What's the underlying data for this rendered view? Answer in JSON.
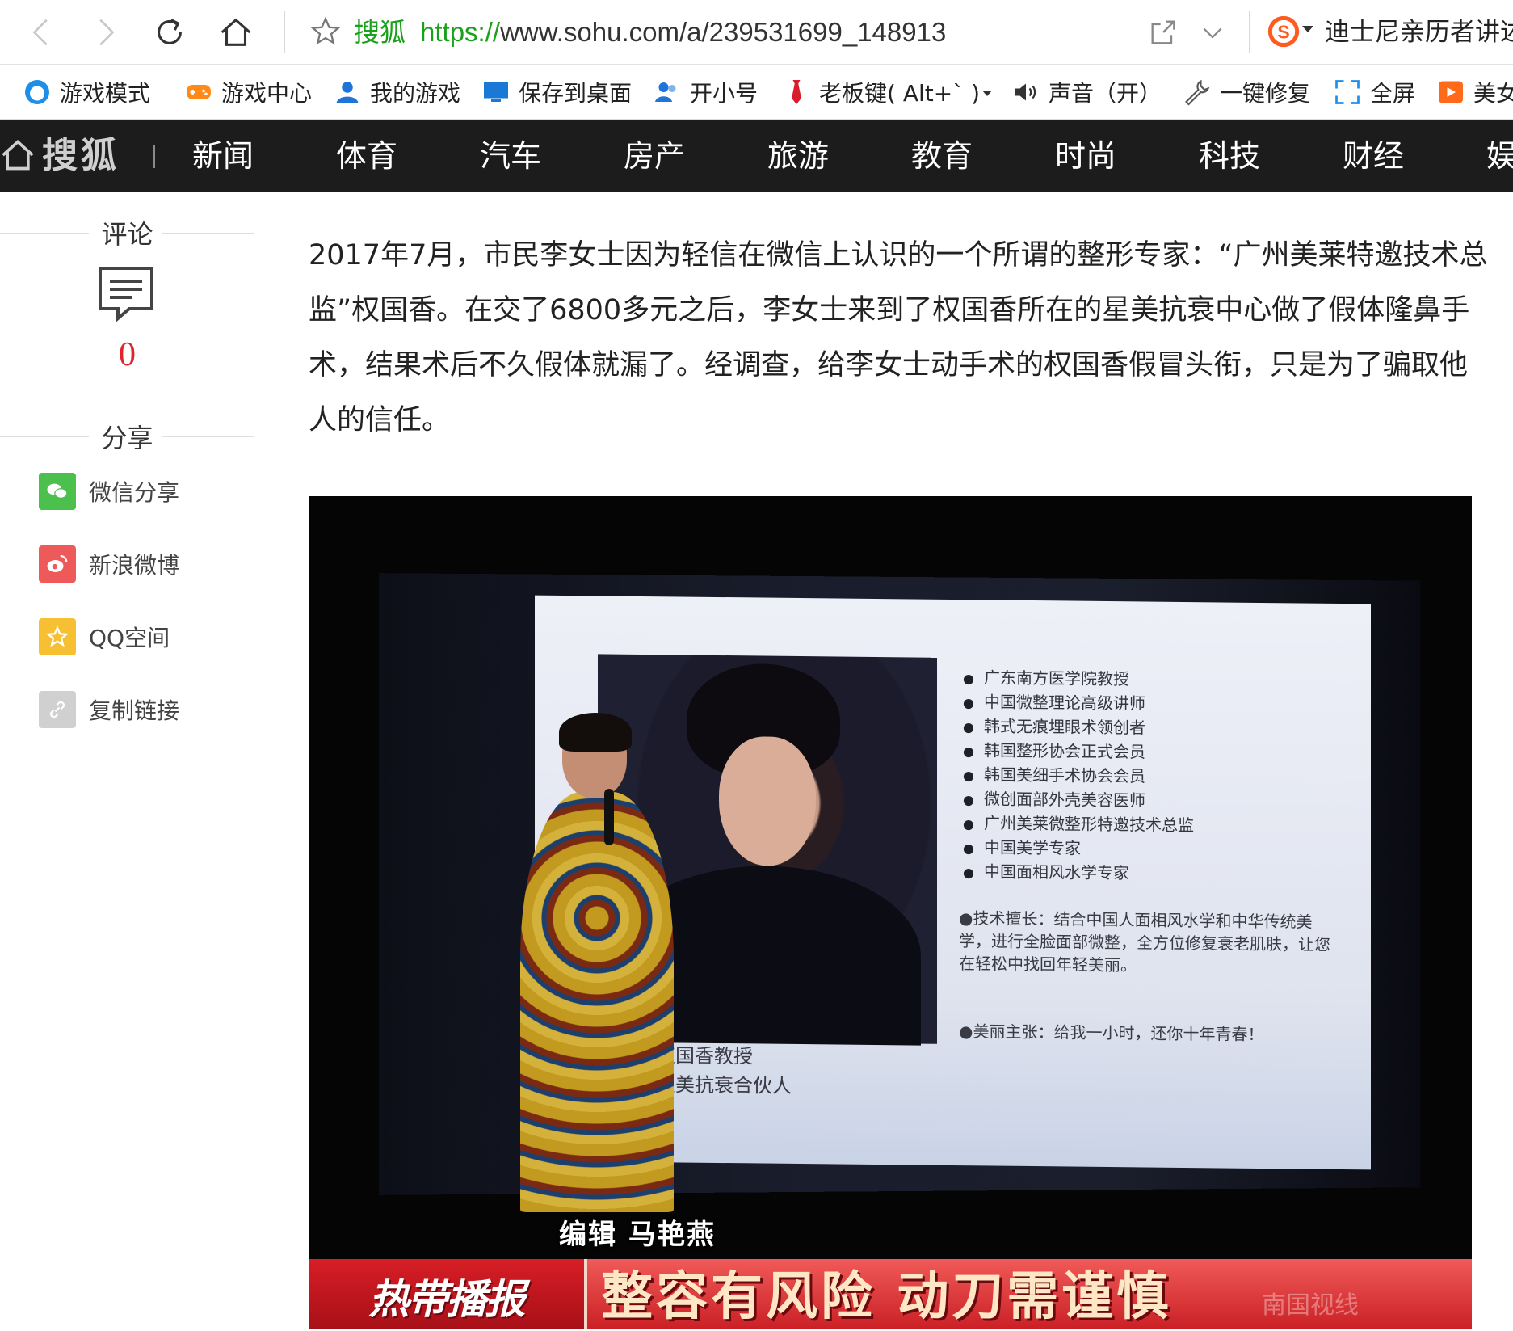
{
  "browser": {
    "site_name": "搜狐",
    "url_scheme": "https://",
    "url_rest": "www.sohu.com/a/239531699_148913",
    "search_hint": "迪士尼亲历者讲述"
  },
  "bookmarks": [
    {
      "label": "游戏模式",
      "icon": "game-mode-icon"
    },
    {
      "label": "游戏中心",
      "icon": "gamepad-icon"
    },
    {
      "label": "我的游戏",
      "icon": "user-icon"
    },
    {
      "label": "保存到桌面",
      "icon": "monitor-icon"
    },
    {
      "label": "开小号",
      "icon": "users-icon"
    },
    {
      "label": "老板键( Alt+` )",
      "icon": "necktie-icon"
    },
    {
      "label": "声音（开）",
      "icon": "speaker-icon"
    },
    {
      "label": "一键修复",
      "icon": "wrench-icon"
    },
    {
      "label": "全屏",
      "icon": "fullscreen-icon"
    },
    {
      "label": "美女",
      "icon": "play-icon"
    }
  ],
  "sohu_nav": {
    "logo": "搜狐",
    "items": [
      "新闻",
      "体育",
      "汽车",
      "房产",
      "旅游",
      "教育",
      "时尚",
      "科技",
      "财经",
      "娱"
    ]
  },
  "left_rail": {
    "comment_title": "评论",
    "comment_count": "0",
    "share_title": "分享",
    "share_items": [
      {
        "label": "微信分享",
        "color": "#4cc04c"
      },
      {
        "label": "新浪微博",
        "color": "#ee5a5a"
      },
      {
        "label": "QQ空间",
        "color": "#f7c033"
      },
      {
        "label": "复制链接",
        "color": "#d0d0d0"
      }
    ]
  },
  "article": {
    "paragraph": "2017年7月，市民李女士因为轻信在微信上认识的一个所谓的整形专家：“广州美莱特邀技术总监”权国香。在交了6800多元之后，李女士来到了权国香所在的星美抗衰中心做了假体隆鼻手术，结果术后不久假体就漏了。经调查，给李女士动手术的权国香假冒头衔，只是为了骗取他人的信任。"
  },
  "photo": {
    "slide_bullets": [
      "广东南方医学院教授",
      "中国微整理论高级讲师",
      "韩式无痕埋眼术领创者",
      "韩国整形协会正式会员",
      "韩国美细手术协会会员",
      "微创面部外壳美容医师",
      "广州美莱微整形特邀技术总监",
      "中国美学专家",
      "中国面相风水学专家"
    ],
    "slide_desc": "●技术擅长：结合中国人面相风水学和中华传统美学，进行全脸面部微整，全方位修复衰老肌肤，让您在轻松中找回年轻美丽。",
    "slide_slogan": "●美丽主张：给我一小时，还你十年青春！",
    "caption_line1": "权国香教授",
    "caption_line2": "星美抗衰合伙人",
    "editor_subtitle": "编辑 马艳燕",
    "program_badge": "热带播报",
    "headline": "整容有风险 动刀需谨慎",
    "watermark": "南国视线"
  }
}
